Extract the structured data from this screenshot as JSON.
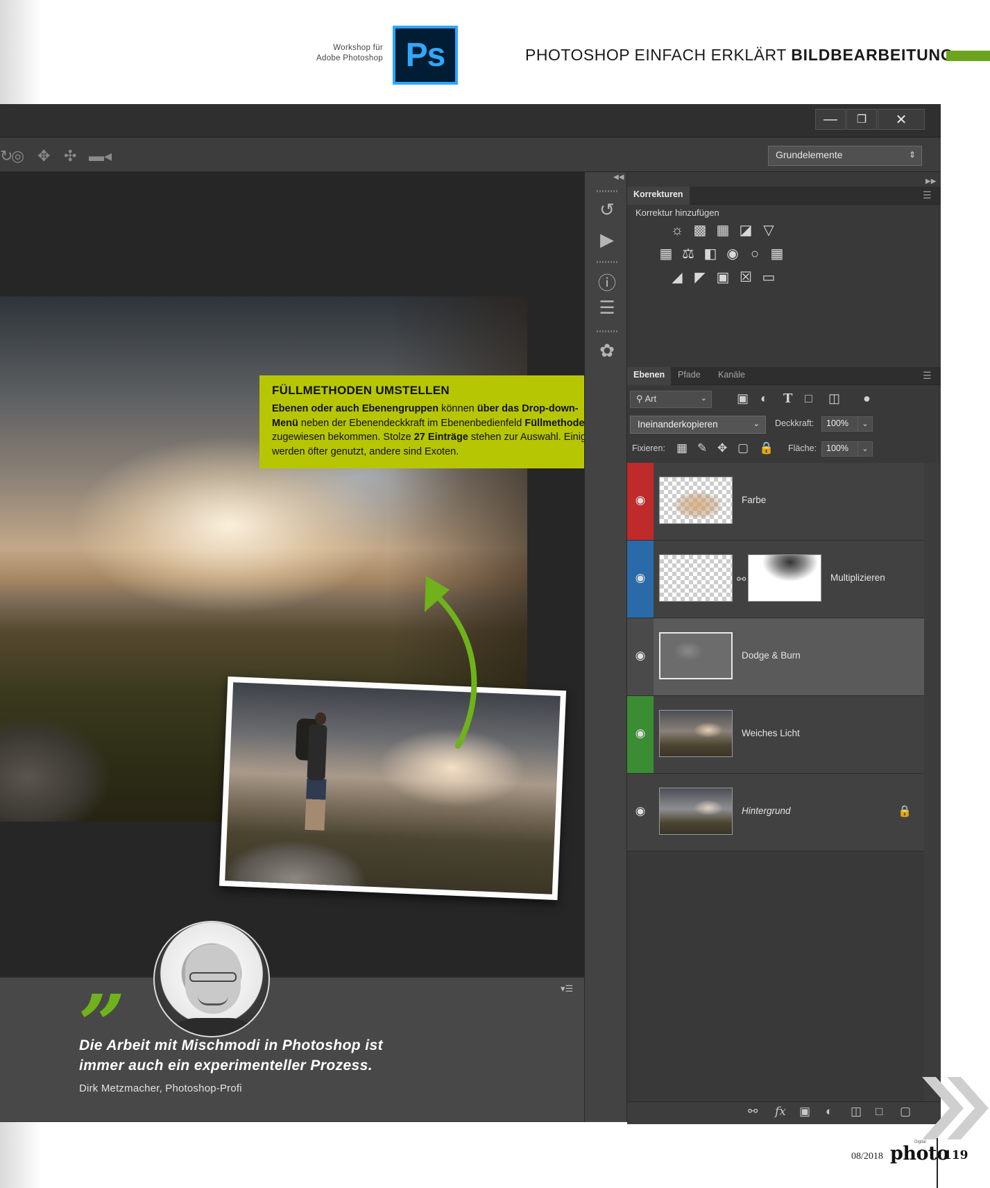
{
  "page_header": {
    "workshop_line1": "Workshop für",
    "workshop_line2": "Adobe Photoshop",
    "logo_text": "Ps",
    "title_regular": "PHOTOSHOP EINFACH ERKLÄRT",
    "title_bold": "BILDBEARBEITUNG",
    "accent_color": "#6ca51d"
  },
  "window": {
    "controls": {
      "minimize_icon": "minimize-icon",
      "restore_icon": "restore-icon",
      "close_icon": "close-icon"
    },
    "options_bar": {
      "tool_icons": [
        "rotate-3d-icon",
        "roll-3d-icon",
        "pan-3d-icon",
        "slide-3d-icon",
        "scale-3d-icon"
      ],
      "workspace": "Grundelemente"
    }
  },
  "callout": {
    "title": "FÜLLMETHODEN UMSTELLEN",
    "p1": "Ebenen oder auch Ebenengruppen",
    "p2": " können ",
    "p3": "über das Drop-down-Menü",
    "p4": " neben der Ebenendeckkraft im Ebenenbedienfeld ",
    "p5": "Füllmethoden",
    "p6": " zugewiesen bekommen. Stolze ",
    "p7": "27 Einträge",
    "p8": " stehen zur Auswahl. Einige werden öfter genutzt, andere sind Exoten.",
    "color": "#b7c603"
  },
  "quote": {
    "mark": "”",
    "line1": "Die Arbeit mit Mischmodi in Photoshop ist",
    "line2": "immer auch ein experimenteller Prozess.",
    "author": "Dirk Metzmacher, Photoshop-Profi",
    "mark_color": "#6fb21b"
  },
  "dock": {
    "icons": [
      "history-icon",
      "actions-play-icon",
      "info-icon",
      "properties-icon",
      "brush-presets-icon"
    ]
  },
  "corrections_panel": {
    "tab": "Korrekturen",
    "subtitle": "Korrektur hinzufügen",
    "row1": [
      "brightness-icon",
      "levels-icon",
      "curves-icon",
      "exposure-icon",
      "vibrance-icon"
    ],
    "row2": [
      "hue-saturation-icon",
      "color-balance-icon",
      "black-white-icon",
      "photo-filter-icon",
      "channel-mixer-icon",
      "color-lookup-icon"
    ],
    "row3": [
      "invert-icon",
      "posterize-icon",
      "threshold-icon",
      "selective-color-icon",
      "gradient-map-icon"
    ]
  },
  "layers_panel": {
    "tabs": [
      "Ebenen",
      "Pfade",
      "Kanäle"
    ],
    "filter_kind": "Art",
    "blend_mode": "Ineinanderkopieren",
    "opacity_label": "Deckkraft:",
    "opacity_value": "100%",
    "lock_label": "Fixieren:",
    "fill_label": "Fläche:",
    "fill_value": "100%",
    "layers": [
      {
        "name": "Farbe",
        "color": "#c02a2a"
      },
      {
        "name": "Multiplizieren",
        "color": "#2a6aa8"
      },
      {
        "name": "Dodge & Burn",
        "color": ""
      },
      {
        "name": "Weiches Licht",
        "color": "#3b8d33"
      },
      {
        "name": "Hintergrund",
        "color": ""
      }
    ],
    "bottom_icons": [
      "link-layers-icon",
      "layer-style-fx-icon",
      "add-mask-icon",
      "new-adjustment-icon",
      "new-group-icon",
      "new-layer-icon",
      "delete-layer-icon"
    ]
  },
  "page_footer": {
    "issue": "08/2018",
    "brand": "photo",
    "brand_tag": "Digital",
    "page_number": "119"
  }
}
